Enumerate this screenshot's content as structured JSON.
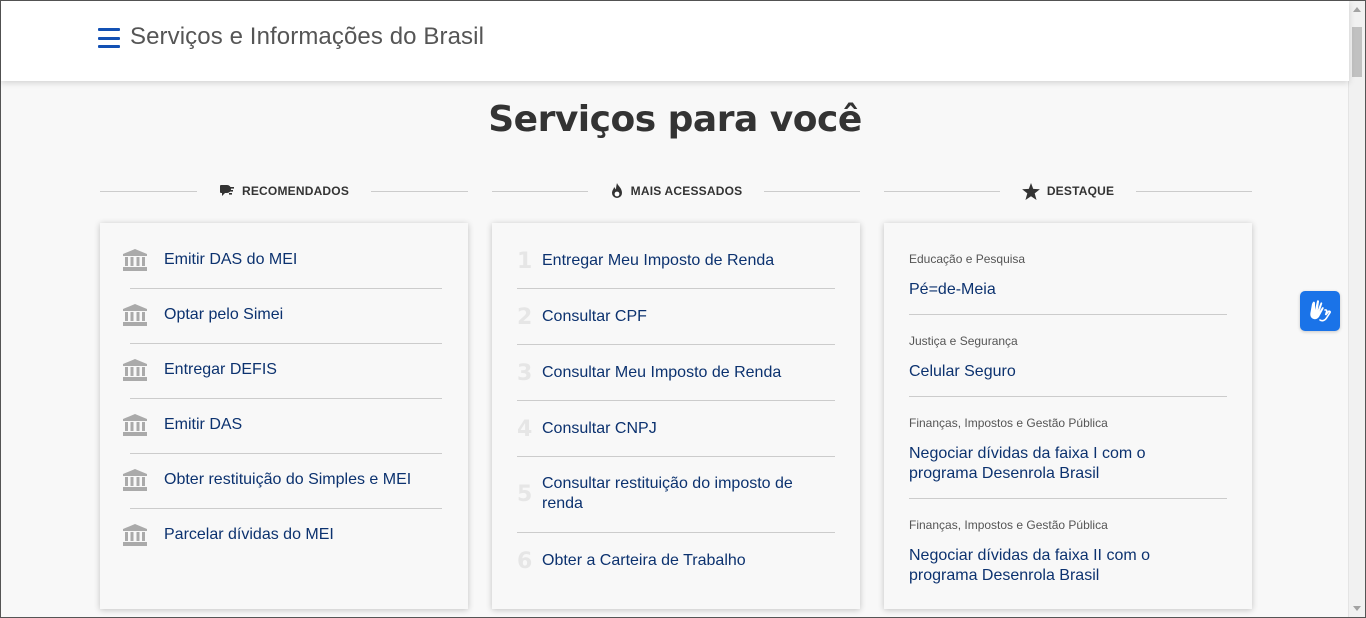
{
  "header": {
    "title": "Serviços e Informações do Brasil",
    "menu_icon": "hamburger-menu-icon"
  },
  "page": {
    "heading": "Serviços para você"
  },
  "sections": {
    "recommended": {
      "label": "RECOMENDADOS",
      "icon": "recommended-icon",
      "items": [
        {
          "label": "Emitir DAS do MEI",
          "icon": "government-building-icon"
        },
        {
          "label": "Optar pelo Simei",
          "icon": "government-building-icon"
        },
        {
          "label": "Entregar DEFIS",
          "icon": "government-building-icon"
        },
        {
          "label": "Emitir DAS",
          "icon": "government-building-icon"
        },
        {
          "label": "Obter restituição do Simples e MEI",
          "icon": "government-building-icon"
        },
        {
          "label": "Parcelar dívidas do MEI",
          "icon": "government-building-icon"
        }
      ]
    },
    "most_accessed": {
      "label": "MAIS ACESSADOS",
      "icon": "fire-icon",
      "items": [
        {
          "num": "1",
          "label": "Entregar Meu Imposto de Renda"
        },
        {
          "num": "2",
          "label": "Consultar CPF"
        },
        {
          "num": "3",
          "label": "Consultar Meu Imposto de Renda"
        },
        {
          "num": "4",
          "label": "Consultar CNPJ"
        },
        {
          "num": "5",
          "label": "Consultar restituição do imposto de renda"
        },
        {
          "num": "6",
          "label": "Obter a Carteira de Trabalho"
        }
      ]
    },
    "highlight": {
      "label": "DESTAQUE",
      "icon": "star-icon",
      "items": [
        {
          "category": "Educação e Pesquisa",
          "title": "Pé=de-Meia"
        },
        {
          "category": "Justiça e Segurança",
          "title": "Celular Seguro"
        },
        {
          "category": "Finanças, Impostos e Gestão Pública",
          "title": "Negociar dívidas da faixa I com o programa Desenrola Brasil"
        },
        {
          "category": "Finanças, Impostos e Gestão Pública",
          "title": "Negociar dívidas da faixa II com o programa Desenrola Brasil"
        }
      ]
    }
  },
  "widgets": {
    "vlibras_icon": "sign-language-hands-icon"
  },
  "colors": {
    "brand_blue": "#1351b4",
    "link_blue": "#0c326f",
    "vlibras_blue": "#1a73e8"
  }
}
